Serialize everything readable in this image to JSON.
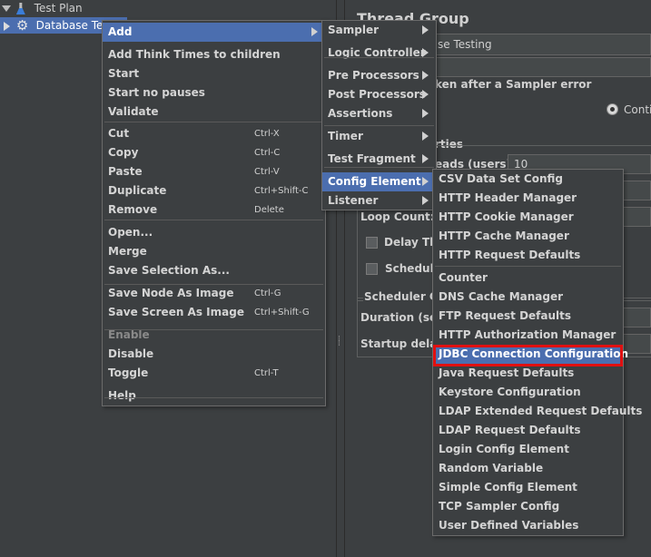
{
  "tree": {
    "root_label": "Test Plan",
    "child_label": "Database Te"
  },
  "panel": {
    "title": "Thread Group",
    "name_value": "se Testing",
    "error_label": "ken after a Sampler error",
    "continue_label": "Conti",
    "properties_label": "rties",
    "threads_label": "eads (users):",
    "threads_value": "10",
    "loop_label": "Loop Count:",
    "delay_label": "Delay Thr",
    "scheduler_label": "Schedule",
    "scheduler_config_label": "Scheduler Co",
    "duration_label": "Duration (seco",
    "startup_label": "Startup delay"
  },
  "menu_main": {
    "items": [
      {
        "label": "Add"
      },
      {
        "label": "Add Think Times to children"
      },
      {
        "label": "Start"
      },
      {
        "label": "Start no pauses"
      },
      {
        "label": "Validate"
      },
      {
        "label": "Cut",
        "shortcut": "Ctrl-X"
      },
      {
        "label": "Copy",
        "shortcut": "Ctrl-C"
      },
      {
        "label": "Paste",
        "shortcut": "Ctrl-V"
      },
      {
        "label": "Duplicate",
        "shortcut": "Ctrl+Shift-C"
      },
      {
        "label": "Remove",
        "shortcut": "Delete"
      },
      {
        "label": "Open..."
      },
      {
        "label": "Merge"
      },
      {
        "label": "Save Selection As..."
      },
      {
        "label": "Save Node As Image",
        "shortcut": "Ctrl-G"
      },
      {
        "label": "Save Screen As Image",
        "shortcut": "Ctrl+Shift-G"
      },
      {
        "label": "Enable"
      },
      {
        "label": "Disable"
      },
      {
        "label": "Toggle",
        "shortcut": "Ctrl-T"
      },
      {
        "label": "Help"
      }
    ]
  },
  "menu_add": {
    "items": [
      {
        "label": "Sampler"
      },
      {
        "label": "Logic Controller"
      },
      {
        "label": "Pre Processors"
      },
      {
        "label": "Post Processors"
      },
      {
        "label": "Assertions"
      },
      {
        "label": "Timer"
      },
      {
        "label": "Test Fragment"
      },
      {
        "label": "Config Element"
      },
      {
        "label": "Listener"
      }
    ]
  },
  "menu_config": {
    "items": [
      {
        "label": "CSV Data Set Config"
      },
      {
        "label": "HTTP Header Manager"
      },
      {
        "label": "HTTP Cookie Manager"
      },
      {
        "label": "HTTP Cache Manager"
      },
      {
        "label": "HTTP Request Defaults"
      },
      {
        "label": "Counter"
      },
      {
        "label": "DNS Cache Manager"
      },
      {
        "label": "FTP Request Defaults"
      },
      {
        "label": "HTTP Authorization Manager"
      },
      {
        "label": "JDBC Connection Configuration"
      },
      {
        "label": "Java Request Defaults"
      },
      {
        "label": "Keystore Configuration"
      },
      {
        "label": "LDAP Extended Request Defaults"
      },
      {
        "label": "LDAP Request Defaults"
      },
      {
        "label": "Login Config Element"
      },
      {
        "label": "Random Variable"
      },
      {
        "label": "Simple Config Element"
      },
      {
        "label": "TCP Sampler Config"
      },
      {
        "label": "User Defined Variables"
      }
    ]
  },
  "colors": {
    "background": "#3c3f41",
    "selection": "#4b6eaf",
    "highlight_box": "#e01010"
  }
}
